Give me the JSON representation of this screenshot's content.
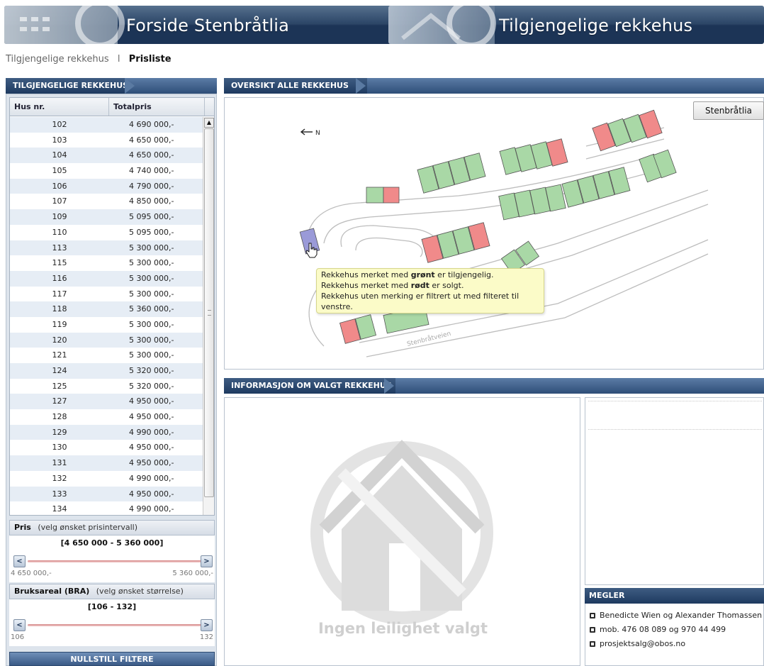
{
  "header": {
    "left_title": "Forside Stenbråtlia",
    "right_title": "Tilgjengelige rekkehus"
  },
  "breadcrumb": {
    "item1": "Tilgjengelige rekkehus",
    "separator": "I",
    "item2": "Prisliste"
  },
  "left_panel": {
    "title": "TILGJENGELIGE REKKEHUS",
    "columns": [
      "Hus nr.",
      "Totalpris"
    ],
    "rows": [
      {
        "nr": "102",
        "price": "4 690 000,-"
      },
      {
        "nr": "103",
        "price": "4 650 000,-"
      },
      {
        "nr": "104",
        "price": "4 650 000,-"
      },
      {
        "nr": "105",
        "price": "4 740 000,-"
      },
      {
        "nr": "106",
        "price": "4 790 000,-"
      },
      {
        "nr": "107",
        "price": "4 850 000,-"
      },
      {
        "nr": "109",
        "price": "5 095 000,-"
      },
      {
        "nr": "110",
        "price": "5 095 000,-"
      },
      {
        "nr": "113",
        "price": "5 300 000,-"
      },
      {
        "nr": "115",
        "price": "5 300 000,-"
      },
      {
        "nr": "116",
        "price": "5 300 000,-"
      },
      {
        "nr": "117",
        "price": "5 300 000,-"
      },
      {
        "nr": "118",
        "price": "5 360 000,-"
      },
      {
        "nr": "119",
        "price": "5 300 000,-"
      },
      {
        "nr": "120",
        "price": "5 300 000,-"
      },
      {
        "nr": "121",
        "price": "5 300 000,-"
      },
      {
        "nr": "124",
        "price": "5 320 000,-"
      },
      {
        "nr": "125",
        "price": "5 320 000,-"
      },
      {
        "nr": "127",
        "price": "4 950 000,-"
      },
      {
        "nr": "128",
        "price": "4 950 000,-"
      },
      {
        "nr": "129",
        "price": "4 990 000,-"
      },
      {
        "nr": "130",
        "price": "4 950 000,-"
      },
      {
        "nr": "131",
        "price": "4 950 000,-"
      },
      {
        "nr": "132",
        "price": "4 990 000,-"
      },
      {
        "nr": "133",
        "price": "4 950 000,-"
      },
      {
        "nr": "134",
        "price": "4 990 000,-"
      }
    ]
  },
  "price_filter": {
    "label": "Pris",
    "hint": "(velg ønsket prisintervall)",
    "range_text": "[4 650 000 - 5 360 000]",
    "min_label": "4 650 000,-",
    "max_label": "5 360 000,-"
  },
  "area_filter": {
    "label": "Bruksareal (BRA)",
    "hint": "(velg ønsket størrelse)",
    "range_text": "[106 - 132]",
    "min_label": "106",
    "max_label": "132"
  },
  "reset_label": "NULLSTILL FILTERE",
  "map_panel": {
    "title": "OVERSIKT ALLE REKKEHUS",
    "button_label": "Stenbråtlia",
    "north_label": "N",
    "road_label": "Stenbråtveien",
    "tooltip": {
      "line1_pre": "Rekkehus merket med ",
      "line1_bold": "grønt",
      "line1_post": " er tilgjengelig.",
      "line2_pre": "Rekkehus merket med ",
      "line2_bold": "rødt",
      "line2_post": " er solgt.",
      "line3": "Rekkehus uten merking er filtrert ut med filteret til",
      "line4": "venstre."
    },
    "colors": {
      "available": "#a9d8a6",
      "sold": "#f08a8a",
      "selected": "#9a9ad8"
    }
  },
  "info_panel": {
    "title": "INFORMASJON OM VALGT REKKEHUS",
    "empty_text": "Ingen leilighet valgt"
  },
  "megler": {
    "title": "MEGLER",
    "name": "Benedicte Wien og Alexander Thomassen",
    "phone": "mob. 476 08 089 og 970 44 499",
    "email": "prosjektsalg@obos.no"
  }
}
